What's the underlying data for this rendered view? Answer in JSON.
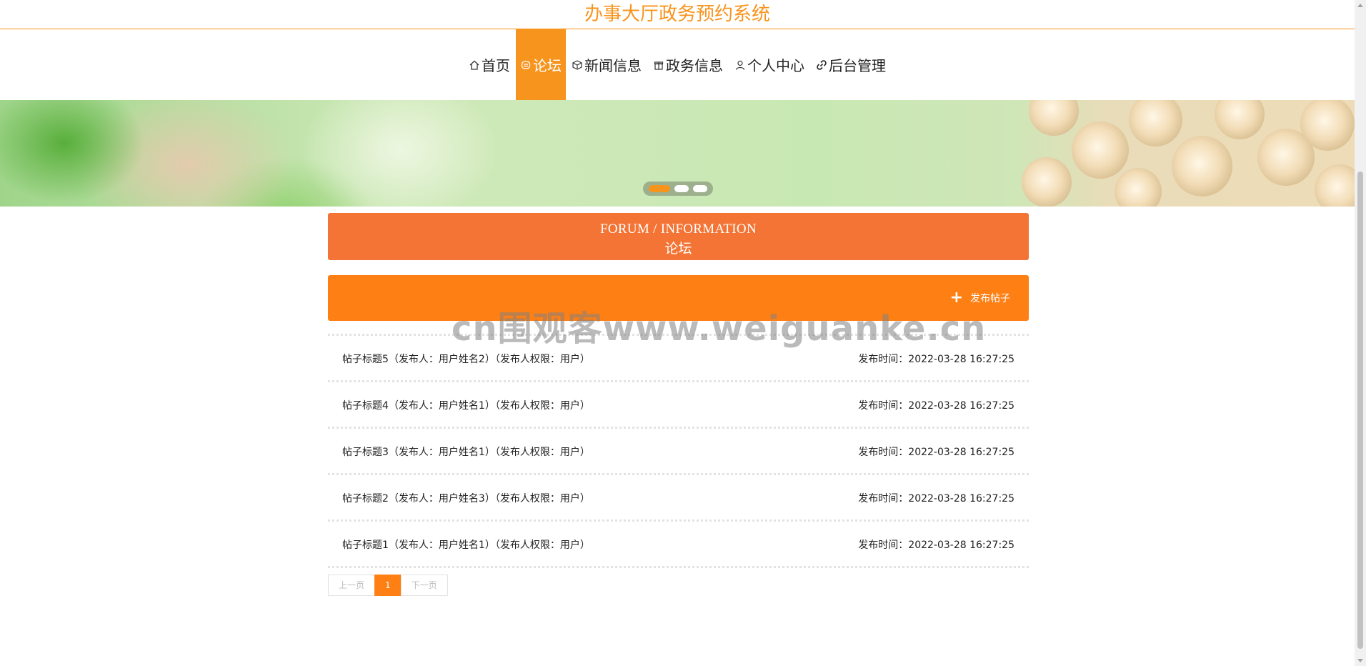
{
  "site": {
    "title": "办事大厅政务预约系统"
  },
  "nav": {
    "items": [
      {
        "label": "首页",
        "icon": "home-icon"
      },
      {
        "label": "论坛",
        "icon": "forum-icon",
        "active": true
      },
      {
        "label": "新闻信息",
        "icon": "cube-icon"
      },
      {
        "label": "政务信息",
        "icon": "gift-icon"
      },
      {
        "label": "个人中心",
        "icon": "user-icon"
      },
      {
        "label": "后台管理",
        "icon": "link-icon"
      }
    ]
  },
  "banner": {
    "slides": 3,
    "active_slide": 1
  },
  "forum_header": {
    "en": "FORUM / INFORMATION",
    "cn": "论坛"
  },
  "actions": {
    "post_label": "发布帖子",
    "post_icon": "plus-icon"
  },
  "watermark": "cn围观客www.weiguanke.cn",
  "posts": [
    {
      "title": "帖子标题5（发布人：用户姓名2）（发布人权限：用户）",
      "time": "发布时间：2022-03-28 16:27:25"
    },
    {
      "title": "帖子标题4（发布人：用户姓名1）（发布人权限：用户）",
      "time": "发布时间：2022-03-28 16:27:25"
    },
    {
      "title": "帖子标题3（发布人：用户姓名1）（发布人权限：用户）",
      "time": "发布时间：2022-03-28 16:27:25"
    },
    {
      "title": "帖子标题2（发布人：用户姓名3）（发布人权限：用户）",
      "time": "发布时间：2022-03-28 16:27:25"
    },
    {
      "title": "帖子标题1（发布人：用户姓名1）（发布人权限：用户）",
      "time": "发布时间：2022-03-28 16:27:25"
    }
  ],
  "pagination": {
    "prev": "上一页",
    "current": "1",
    "next": "下一页"
  },
  "colors": {
    "accent": "#f7941d",
    "header_bg": "#f37435",
    "bar_bg": "#fe7f14"
  }
}
